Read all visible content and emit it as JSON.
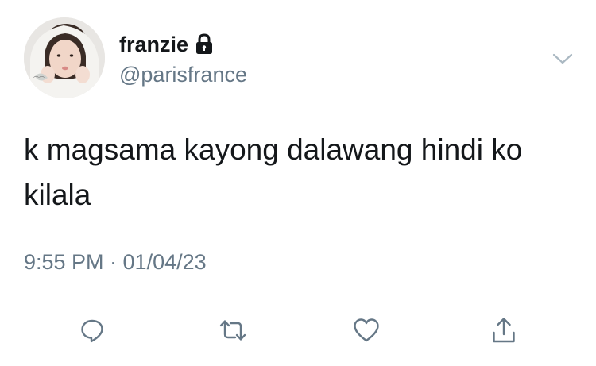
{
  "tweet": {
    "author": {
      "display_name": "franzie",
      "handle": "@parisfrance",
      "avatar_icon": "profile-photo",
      "protected_icon": "lock-icon"
    },
    "text": "k magsama kayong dalawang hindi ko kilala",
    "timestamp": "9:55 PM · 01/04/23",
    "menu_icon": "chevron-down-icon"
  },
  "actions": [
    {
      "name": "reply",
      "icon": "reply-icon"
    },
    {
      "name": "retweet",
      "icon": "retweet-icon"
    },
    {
      "name": "like",
      "icon": "heart-icon"
    },
    {
      "name": "share",
      "icon": "share-icon"
    }
  ],
  "colors": {
    "text_primary": "#14171a",
    "text_secondary": "#657786",
    "icon_gray": "#657786",
    "divider": "#e1e8ed",
    "background": "#ffffff"
  }
}
